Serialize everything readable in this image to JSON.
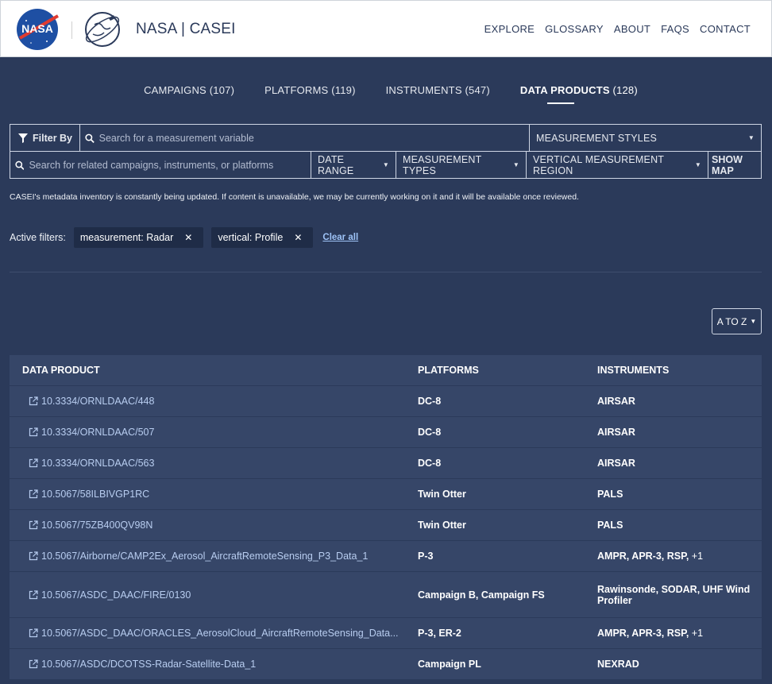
{
  "header": {
    "brand": "NASA | CASEI",
    "nav": [
      "EXPLORE",
      "GLOSSARY",
      "ABOUT",
      "FAQS",
      "CONTACT"
    ]
  },
  "tabs": [
    {
      "label": "CAMPAIGNS",
      "count": "(107)"
    },
    {
      "label": "PLATFORMS",
      "count": "(119)"
    },
    {
      "label": "INSTRUMENTS",
      "count": "(547)"
    },
    {
      "label": "DATA PRODUCTS",
      "count": "(128)",
      "active": true
    }
  ],
  "filters": {
    "filter_by": "Filter By",
    "measurement_search_placeholder": "Search for a measurement variable",
    "measurement_styles": "MEASUREMENT STYLES",
    "related_search_placeholder": "Search for related campaigns, instruments, or platforms",
    "date_range": "DATE RANGE",
    "measurement_types": "MEASUREMENT TYPES",
    "vertical_region": "VERTICAL MEASUREMENT REGION",
    "show_map": "SHOW MAP"
  },
  "notice": "CASEI's metadata inventory is constantly being updated. If content is unavailable, we may be currently working on it and it will be available once reviewed.",
  "active_filters": {
    "label": "Active filters:",
    "chips": [
      "measurement: Radar",
      "vertical: Profile"
    ],
    "clear": "Clear all"
  },
  "sort": {
    "label": "A TO Z"
  },
  "table": {
    "headers": [
      "DATA PRODUCT",
      "PLATFORMS",
      "INSTRUMENTS"
    ],
    "rows": [
      {
        "product": "10.3334/ORNLDAAC/448",
        "platforms": "DC-8",
        "instruments": "AIRSAR",
        "extra": ""
      },
      {
        "product": "10.3334/ORNLDAAC/507",
        "platforms": "DC-8",
        "instruments": "AIRSAR",
        "extra": ""
      },
      {
        "product": "10.3334/ORNLDAAC/563",
        "platforms": "DC-8",
        "instruments": "AIRSAR",
        "extra": ""
      },
      {
        "product": "10.5067/58ILBIVGP1RC",
        "platforms": "Twin Otter",
        "instruments": "PALS",
        "extra": ""
      },
      {
        "product": "10.5067/75ZB400QV98N",
        "platforms": "Twin Otter",
        "instruments": "PALS",
        "extra": ""
      },
      {
        "product": "10.5067/Airborne/CAMP2Ex_Aerosol_AircraftRemoteSensing_P3_Data_1",
        "platforms": "P-3",
        "instruments": "AMPR, APR-3, RSP,",
        "extra": " +1"
      },
      {
        "product": "10.5067/ASDC_DAAC/FIRE/0130",
        "platforms": "Campaign B, Campaign FS",
        "instruments": "Rawinsonde, SODAR, UHF Wind Profiler",
        "extra": ""
      },
      {
        "product": "10.5067/ASDC_DAAC/ORACLES_AerosolCloud_AircraftRemoteSensing_Data...",
        "platforms": "P-3, ER-2",
        "instruments": "AMPR, APR-3, RSP,",
        "extra": " +1"
      },
      {
        "product": "10.5067/ASDC/DCOTSS-Radar-Satellite-Data_1",
        "platforms": "Campaign PL",
        "instruments": "NEXRAD",
        "extra": ""
      }
    ]
  }
}
